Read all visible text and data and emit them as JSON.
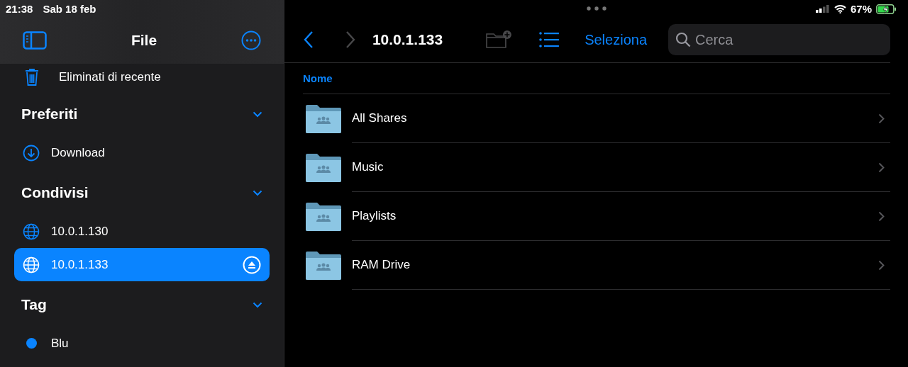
{
  "status_bar": {
    "time": "21:38",
    "date": "Sab 18 feb",
    "battery": "67%"
  },
  "sidebar": {
    "title": "File",
    "recent": {
      "label": "Eliminati di recente"
    },
    "sections": [
      {
        "title": "Preferiti",
        "expanded": true,
        "items": [
          {
            "kind": "download",
            "label": "Download",
            "selected": false
          }
        ]
      },
      {
        "title": "Condivisi",
        "expanded": true,
        "items": [
          {
            "kind": "network",
            "label": "10.0.1.130",
            "selected": false
          },
          {
            "kind": "network",
            "label": "10.0.1.133",
            "selected": true
          }
        ]
      },
      {
        "title": "Tag",
        "expanded": true,
        "items": [
          {
            "kind": "tag",
            "label": "Blu",
            "selected": false,
            "color": "#0a84ff"
          }
        ]
      }
    ]
  },
  "toolbar": {
    "back_enabled": true,
    "forward_enabled": false,
    "title": "10.0.1.133",
    "new_folder_enabled": false,
    "select_label": "Seleziona",
    "search": {
      "placeholder": "Cerca"
    }
  },
  "list": {
    "column": "Nome",
    "rows": [
      {
        "name": "All Shares"
      },
      {
        "name": "Music"
      },
      {
        "name": "Playlists"
      },
      {
        "name": "RAM Drive"
      }
    ]
  }
}
